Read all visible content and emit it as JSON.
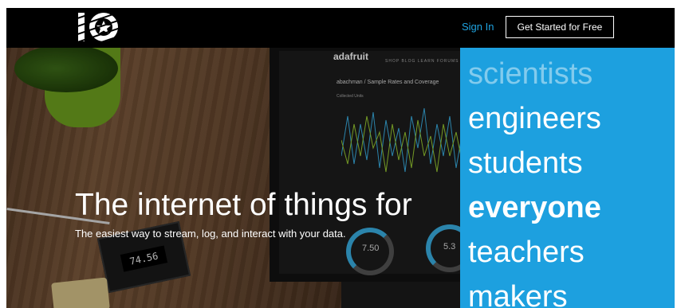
{
  "header": {
    "signin_label": "Sign In",
    "cta_label": "Get Started for Free"
  },
  "hero": {
    "headline": "The internet of things for",
    "subheadline": "The easiest way to stream, log, and interact with your data.",
    "words": [
      {
        "text": "scientists",
        "state": "dim"
      },
      {
        "text": "engineers",
        "state": "normal"
      },
      {
        "text": "students",
        "state": "normal"
      },
      {
        "text": "everyone",
        "state": "active"
      },
      {
        "text": "teachers",
        "state": "normal"
      },
      {
        "text": "makers",
        "state": "normal"
      }
    ]
  },
  "laptop_screen": {
    "site_logo": "adafruit",
    "nav": "SHOP   BLOG   LEARN   FORUMS",
    "page_title": "abachman / Sample Rates and Coverage",
    "chart_subtitle": "Collected Units",
    "gauge_1_value": "7.50",
    "gauge_2_value": "5.3"
  },
  "device": {
    "display_value": "74.56"
  },
  "colors": {
    "accent_blue": "#1da0df",
    "link_blue": "#1fa3e0",
    "topbar": "#000000"
  }
}
